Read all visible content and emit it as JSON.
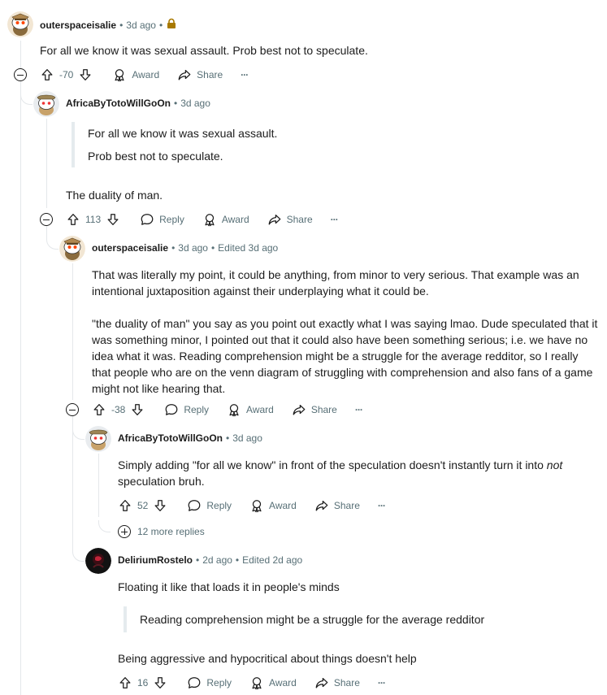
{
  "actions": {
    "reply": "Reply",
    "award": "Award",
    "share": "Share",
    "more": "···"
  },
  "comments": [
    {
      "user": "outerspaceisalie",
      "age": "3d ago",
      "paragraphs": [
        "For all we know it was sexual assault. Prob best not to speculate."
      ],
      "votes": "-70",
      "locked": true
    },
    {
      "user": "AfricaByTotoWillGoOn",
      "age": "3d ago",
      "quote": [
        "For all we know it was sexual assault.",
        "Prob best not to speculate."
      ],
      "paragraphs": [
        "The duality of man."
      ],
      "votes": "113"
    },
    {
      "user": "outerspaceisalie",
      "age": "3d ago",
      "edited": "Edited 3d ago",
      "paragraphs": [
        "That was literally my point, it could be anything, from minor to very serious. That example was an intentional juxtaposition against their underplaying what it could be.",
        "\"the duality of man\" you say as you point out exactly what I was saying lmao. Dude speculated that it was something minor, I pointed out that it could also have been something serious; i.e. we have no idea what it was. Reading comprehension might be a struggle for the average redditor, so I really that people who are on the venn diagram of struggling with comprehension and also fans of a game might not like hearing that."
      ],
      "votes": "-38"
    },
    {
      "user": "AfricaByTotoWillGoOn",
      "age": "3d ago",
      "text_before": "Simply adding \"for all we know\" in front of the speculation doesn't instantly turn it into ",
      "text_italic": "not",
      "text_after": " speculation bruh.",
      "votes": "52",
      "more_replies": "12 more replies"
    },
    {
      "user": "DeliriumRostelo",
      "age": "2d ago",
      "edited": "Edited 2d ago",
      "paragraphs": [
        "Floating it like that loads it in people's minds"
      ],
      "quote": [
        "Reading comprehension might be a struggle for the average redditor"
      ],
      "paragraphs_after": [
        "Being aggressive and hypocritical about things doesn't help"
      ],
      "votes": "16"
    }
  ],
  "icons": [
    "upvote-icon",
    "downvote-icon",
    "reply-icon",
    "award-icon",
    "share-icon",
    "lock-icon",
    "collapse-icon",
    "expand-icon"
  ],
  "colors": {
    "meta": "#576f76",
    "thread": "#e4e7ea",
    "lock": "#a87900"
  }
}
